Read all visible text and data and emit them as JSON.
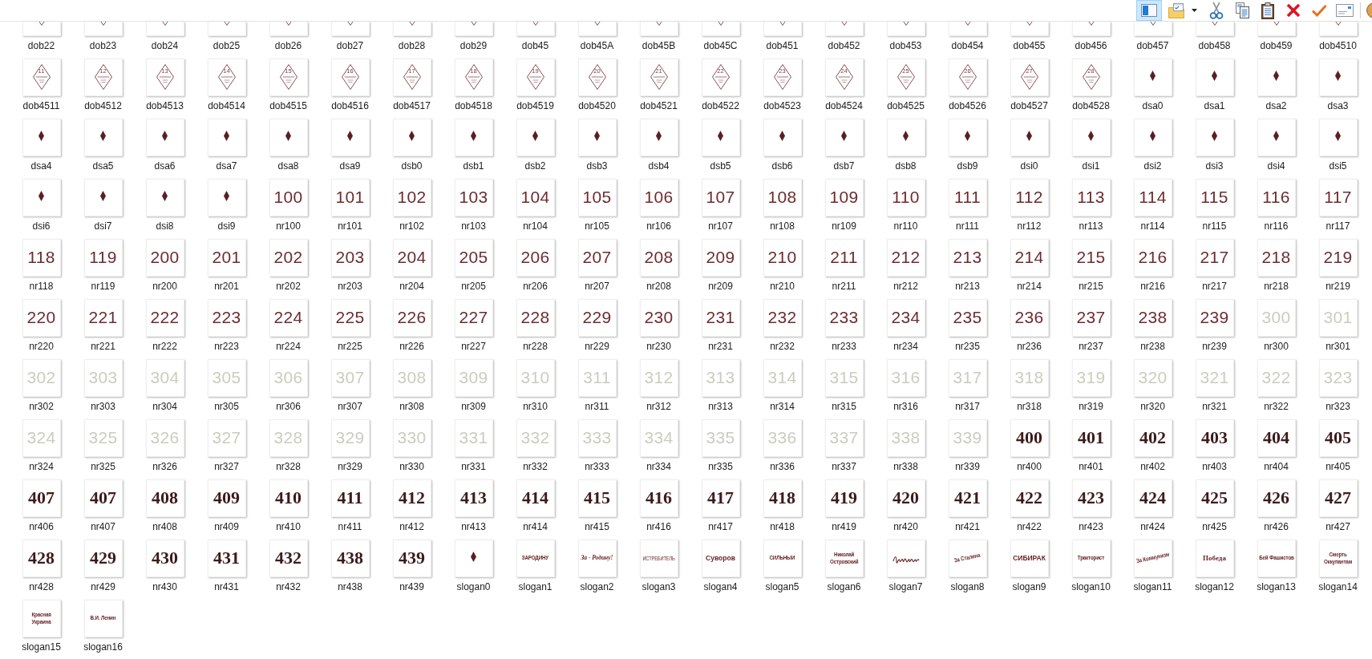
{
  "toolbar": {
    "pane_toggle": {
      "on": true
    },
    "buttons": [
      {
        "kind": "folder"
      },
      {
        "kind": "scissors"
      },
      {
        "kind": "copy"
      },
      {
        "kind": "paste"
      },
      {
        "kind": "delete"
      },
      {
        "kind": "check"
      },
      {
        "kind": "mail"
      },
      {
        "kind": "globe"
      }
    ]
  },
  "files": [
    {
      "name": "dob22",
      "kind": "rhombus"
    },
    {
      "name": "dob23",
      "kind": "rhombus"
    },
    {
      "name": "dob24",
      "kind": "rhombus"
    },
    {
      "name": "dob25",
      "kind": "rhombus"
    },
    {
      "name": "dob26",
      "kind": "rhombus"
    },
    {
      "name": "dob27",
      "kind": "rhombus"
    },
    {
      "name": "dob28",
      "kind": "rhombus"
    },
    {
      "name": "dob29",
      "kind": "rhombus"
    },
    {
      "name": "dob45",
      "kind": "rhombus"
    },
    {
      "name": "dob45A",
      "kind": "rhombus"
    },
    {
      "name": "dob45B",
      "kind": "rhombus"
    },
    {
      "name": "dob45C",
      "kind": "rhombus"
    },
    {
      "name": "dob451",
      "kind": "rhombus"
    },
    {
      "name": "dob452",
      "kind": "rhombus"
    },
    {
      "name": "dob453",
      "kind": "rhombus"
    },
    {
      "name": "dob454",
      "kind": "rhombus"
    },
    {
      "name": "dob455",
      "kind": "rhombus"
    },
    {
      "name": "dob456",
      "kind": "rhombus"
    },
    {
      "name": "dob457",
      "kind": "rhombus"
    },
    {
      "name": "dob458",
      "kind": "rhombus"
    },
    {
      "name": "dob459",
      "kind": "rhombus"
    },
    {
      "name": "dob4510",
      "kind": "rhombus"
    },
    {
      "name": "dob4511",
      "kind": "rhombus",
      "emblem": "11"
    },
    {
      "name": "dob4512",
      "kind": "rhombus",
      "emblem": "12"
    },
    {
      "name": "dob4513",
      "kind": "rhombus",
      "emblem": "13"
    },
    {
      "name": "dob4514",
      "kind": "rhombus",
      "emblem": "14"
    },
    {
      "name": "dob4515",
      "kind": "rhombus",
      "emblem": "15"
    },
    {
      "name": "dob4516",
      "kind": "rhombus",
      "emblem": "16"
    },
    {
      "name": "dob4517",
      "kind": "rhombus",
      "emblem": "17"
    },
    {
      "name": "dob4518",
      "kind": "rhombus",
      "emblem": "18"
    },
    {
      "name": "dob4519",
      "kind": "rhombus",
      "emblem": "19"
    },
    {
      "name": "dob4520",
      "kind": "rhombus",
      "emblem": "20"
    },
    {
      "name": "dob4521",
      "kind": "rhombus",
      "emblem": "21"
    },
    {
      "name": "dob4522",
      "kind": "rhombus",
      "emblem": "22"
    },
    {
      "name": "dob4523",
      "kind": "rhombus",
      "emblem": "23"
    },
    {
      "name": "dob4524",
      "kind": "rhombus",
      "emblem": "24"
    },
    {
      "name": "dob4525",
      "kind": "rhombus",
      "emblem": "25"
    },
    {
      "name": "dob4526",
      "kind": "rhombus",
      "emblem": "26"
    },
    {
      "name": "dob4527",
      "kind": "rhombus",
      "emblem": "27"
    },
    {
      "name": "dob4528",
      "kind": "rhombus",
      "emblem": "28"
    },
    {
      "name": "dsa0",
      "kind": "diamond"
    },
    {
      "name": "dsa1",
      "kind": "diamond"
    },
    {
      "name": "dsa2",
      "kind": "diamond"
    },
    {
      "name": "dsa3",
      "kind": "diamond"
    },
    {
      "name": "dsa4",
      "kind": "diamond"
    },
    {
      "name": "dsa5",
      "kind": "diamond"
    },
    {
      "name": "dsa6",
      "kind": "diamond"
    },
    {
      "name": "dsa7",
      "kind": "diamond"
    },
    {
      "name": "dsa8",
      "kind": "diamond"
    },
    {
      "name": "dsa9",
      "kind": "diamond"
    },
    {
      "name": "dsb0",
      "kind": "diamond"
    },
    {
      "name": "dsb1",
      "kind": "diamond"
    },
    {
      "name": "dsb2",
      "kind": "diamond"
    },
    {
      "name": "dsb3",
      "kind": "diamond"
    },
    {
      "name": "dsb4",
      "kind": "diamond"
    },
    {
      "name": "dsb5",
      "kind": "diamond"
    },
    {
      "name": "dsb6",
      "kind": "diamond"
    },
    {
      "name": "dsb7",
      "kind": "diamond"
    },
    {
      "name": "dsb8",
      "kind": "diamond"
    },
    {
      "name": "dsb9",
      "kind": "diamond"
    },
    {
      "name": "dsi0",
      "kind": "diamond"
    },
    {
      "name": "dsi1",
      "kind": "diamond"
    },
    {
      "name": "dsi2",
      "kind": "diamond"
    },
    {
      "name": "dsi3",
      "kind": "diamond"
    },
    {
      "name": "dsi4",
      "kind": "diamond"
    },
    {
      "name": "dsi5",
      "kind": "diamond"
    },
    {
      "name": "dsi6",
      "kind": "diamond"
    },
    {
      "name": "dsi7",
      "kind": "diamond"
    },
    {
      "name": "dsi8",
      "kind": "diamond"
    },
    {
      "name": "dsi9",
      "kind": "diamond"
    },
    {
      "name": "nr100",
      "kind": "number",
      "text": "100",
      "color": "#6e2b2f"
    },
    {
      "name": "nr101",
      "kind": "number",
      "text": "101",
      "color": "#6e2b2f"
    },
    {
      "name": "nr102",
      "kind": "number",
      "text": "102",
      "color": "#6e2b2f"
    },
    {
      "name": "nr103",
      "kind": "number",
      "text": "103",
      "color": "#6e2b2f"
    },
    {
      "name": "nr104",
      "kind": "number",
      "text": "104",
      "color": "#6e2b2f"
    },
    {
      "name": "nr105",
      "kind": "number",
      "text": "105",
      "color": "#6e2b2f"
    },
    {
      "name": "nr106",
      "kind": "number",
      "text": "106",
      "color": "#6e2b2f"
    },
    {
      "name": "nr107",
      "kind": "number",
      "text": "107",
      "color": "#6e2b2f"
    },
    {
      "name": "nr108",
      "kind": "number",
      "text": "108",
      "color": "#6e2b2f"
    },
    {
      "name": "nr109",
      "kind": "number",
      "text": "109",
      "color": "#6e2b2f"
    },
    {
      "name": "nr110",
      "kind": "number",
      "text": "110",
      "color": "#6e2b2f"
    },
    {
      "name": "nr111",
      "kind": "number",
      "text": "111",
      "color": "#6e2b2f"
    },
    {
      "name": "nr112",
      "kind": "number",
      "text": "112",
      "color": "#6e2b2f"
    },
    {
      "name": "nr113",
      "kind": "number",
      "text": "113",
      "color": "#6e2b2f"
    },
    {
      "name": "nr114",
      "kind": "number",
      "text": "114",
      "color": "#6e2b2f"
    },
    {
      "name": "nr115",
      "kind": "number",
      "text": "115",
      "color": "#6e2b2f"
    },
    {
      "name": "nr116",
      "kind": "number",
      "text": "116",
      "color": "#6e2b2f"
    },
    {
      "name": "nr117",
      "kind": "number",
      "text": "117",
      "color": "#6e2b2f"
    },
    {
      "name": "nr118",
      "kind": "number",
      "text": "118",
      "color": "#6e2b2f"
    },
    {
      "name": "nr119",
      "kind": "number",
      "text": "119",
      "color": "#6e2b2f"
    },
    {
      "name": "nr200",
      "kind": "number",
      "text": "200",
      "color": "#6e2b2f"
    },
    {
      "name": "nr201",
      "kind": "number",
      "text": "201",
      "color": "#6e2b2f"
    },
    {
      "name": "nr202",
      "kind": "number",
      "text": "202",
      "color": "#6e2b2f"
    },
    {
      "name": "nr203",
      "kind": "number",
      "text": "203",
      "color": "#6e2b2f"
    },
    {
      "name": "nr204",
      "kind": "number",
      "text": "204",
      "color": "#6e2b2f"
    },
    {
      "name": "nr205",
      "kind": "number",
      "text": "205",
      "color": "#6e2b2f"
    },
    {
      "name": "nr206",
      "kind": "number",
      "text": "206",
      "color": "#6e2b2f"
    },
    {
      "name": "nr207",
      "kind": "number",
      "text": "207",
      "color": "#6e2b2f"
    },
    {
      "name": "nr208",
      "kind": "number",
      "text": "208",
      "color": "#6e2b2f"
    },
    {
      "name": "nr209",
      "kind": "number",
      "text": "209",
      "color": "#6e2b2f"
    },
    {
      "name": "nr210",
      "kind": "number",
      "text": "210",
      "color": "#6e2b2f"
    },
    {
      "name": "nr211",
      "kind": "number",
      "text": "211",
      "color": "#6e2b2f"
    },
    {
      "name": "nr212",
      "kind": "number",
      "text": "212",
      "color": "#6e2b2f"
    },
    {
      "name": "nr213",
      "kind": "number",
      "text": "213",
      "color": "#6e2b2f"
    },
    {
      "name": "nr214",
      "kind": "number",
      "text": "214",
      "color": "#6e2b2f"
    },
    {
      "name": "nr215",
      "kind": "number",
      "text": "215",
      "color": "#6e2b2f"
    },
    {
      "name": "nr216",
      "kind": "number",
      "text": "216",
      "color": "#6e2b2f"
    },
    {
      "name": "nr217",
      "kind": "number",
      "text": "217",
      "color": "#6e2b2f"
    },
    {
      "name": "nr218",
      "kind": "number",
      "text": "218",
      "color": "#6e2b2f"
    },
    {
      "name": "nr219",
      "kind": "number",
      "text": "219",
      "color": "#6e2b2f"
    },
    {
      "name": "nr220",
      "kind": "number",
      "text": "220",
      "color": "#6e2b2f"
    },
    {
      "name": "nr221",
      "kind": "number",
      "text": "221",
      "color": "#6e2b2f"
    },
    {
      "name": "nr222",
      "kind": "number",
      "text": "222",
      "color": "#6e2b2f"
    },
    {
      "name": "nr223",
      "kind": "number",
      "text": "223",
      "color": "#6e2b2f"
    },
    {
      "name": "nr224",
      "kind": "number",
      "text": "224",
      "color": "#6e2b2f"
    },
    {
      "name": "nr225",
      "kind": "number",
      "text": "225",
      "color": "#6e2b2f"
    },
    {
      "name": "nr226",
      "kind": "number",
      "text": "226",
      "color": "#6e2b2f"
    },
    {
      "name": "nr227",
      "kind": "number",
      "text": "227",
      "color": "#6e2b2f"
    },
    {
      "name": "nr228",
      "kind": "number",
      "text": "228",
      "color": "#6e2b2f"
    },
    {
      "name": "nr229",
      "kind": "number",
      "text": "229",
      "color": "#6e2b2f"
    },
    {
      "name": "nr230",
      "kind": "number",
      "text": "230",
      "color": "#6e2b2f"
    },
    {
      "name": "nr231",
      "kind": "number",
      "text": "231",
      "color": "#6e2b2f"
    },
    {
      "name": "nr232",
      "kind": "number",
      "text": "232",
      "color": "#6e2b2f"
    },
    {
      "name": "nr233",
      "kind": "number",
      "text": "233",
      "color": "#6e2b2f"
    },
    {
      "name": "nr234",
      "kind": "number",
      "text": "234",
      "color": "#6e2b2f"
    },
    {
      "name": "nr235",
      "kind": "number",
      "text": "235",
      "color": "#6e2b2f"
    },
    {
      "name": "nr236",
      "kind": "number",
      "text": "236",
      "color": "#6e2b2f"
    },
    {
      "name": "nr237",
      "kind": "number",
      "text": "237",
      "color": "#6e2b2f"
    },
    {
      "name": "nr238",
      "kind": "number",
      "text": "238",
      "color": "#6e2b2f"
    },
    {
      "name": "nr239",
      "kind": "number",
      "text": "239",
      "color": "#6e2b2f"
    },
    {
      "name": "nr300",
      "kind": "number",
      "text": "300",
      "color": "#c8cec0"
    },
    {
      "name": "nr301",
      "kind": "number",
      "text": "301",
      "color": "#c8cec0"
    },
    {
      "name": "nr302",
      "kind": "number",
      "text": "302",
      "color": "#c8cec0"
    },
    {
      "name": "nr303",
      "kind": "number",
      "text": "303",
      "color": "#c8cec0"
    },
    {
      "name": "nr304",
      "kind": "number",
      "text": "304",
      "color": "#c8cec0"
    },
    {
      "name": "nr305",
      "kind": "number",
      "text": "305",
      "color": "#c8cec0"
    },
    {
      "name": "nr306",
      "kind": "number",
      "text": "306",
      "color": "#c8cec0"
    },
    {
      "name": "nr307",
      "kind": "number",
      "text": "307",
      "color": "#c8cec0"
    },
    {
      "name": "nr308",
      "kind": "number",
      "text": "308",
      "color": "#c8cec0"
    },
    {
      "name": "nr309",
      "kind": "number",
      "text": "309",
      "color": "#c8cec0"
    },
    {
      "name": "nr310",
      "kind": "number",
      "text": "310",
      "color": "#c8cec0"
    },
    {
      "name": "nr311",
      "kind": "number",
      "text": "311",
      "color": "#c8cec0"
    },
    {
      "name": "nr312",
      "kind": "number",
      "text": "312",
      "color": "#c8cec0"
    },
    {
      "name": "nr313",
      "kind": "number",
      "text": "313",
      "color": "#c8cec0"
    },
    {
      "name": "nr314",
      "kind": "number",
      "text": "314",
      "color": "#c8cec0"
    },
    {
      "name": "nr315",
      "kind": "number",
      "text": "315",
      "color": "#c8cec0"
    },
    {
      "name": "nr316",
      "kind": "number",
      "text": "316",
      "color": "#c8cec0"
    },
    {
      "name": "nr317",
      "kind": "number",
      "text": "317",
      "color": "#c8cec0"
    },
    {
      "name": "nr318",
      "kind": "number",
      "text": "318",
      "color": "#c8cec0"
    },
    {
      "name": "nr319",
      "kind": "number",
      "text": "319",
      "color": "#c8cec0"
    },
    {
      "name": "nr320",
      "kind": "number",
      "text": "320",
      "color": "#c8cec0"
    },
    {
      "name": "nr321",
      "kind": "number",
      "text": "321",
      "color": "#c8cec0"
    },
    {
      "name": "nr322",
      "kind": "number",
      "text": "322",
      "color": "#c8cec0"
    },
    {
      "name": "nr323",
      "kind": "number",
      "text": "323",
      "color": "#c8cec0"
    },
    {
      "name": "nr324",
      "kind": "number",
      "text": "324",
      "color": "#c8cec0"
    },
    {
      "name": "nr325",
      "kind": "number",
      "text": "325",
      "color": "#c8cec0"
    },
    {
      "name": "nr326",
      "kind": "number",
      "text": "326",
      "color": "#c8cec0"
    },
    {
      "name": "nr327",
      "kind": "number",
      "text": "327",
      "color": "#c8cec0"
    },
    {
      "name": "nr328",
      "kind": "number",
      "text": "328",
      "color": "#c8cec0"
    },
    {
      "name": "nr329",
      "kind": "number",
      "text": "329",
      "color": "#c8cec0"
    },
    {
      "name": "nr330",
      "kind": "number",
      "text": "330",
      "color": "#c8cec0"
    },
    {
      "name": "nr331",
      "kind": "number",
      "text": "331",
      "color": "#c8cec0"
    },
    {
      "name": "nr332",
      "kind": "number",
      "text": "332",
      "color": "#c8cec0"
    },
    {
      "name": "nr333",
      "kind": "number",
      "text": "333",
      "color": "#c8cec0"
    },
    {
      "name": "nr334",
      "kind": "number",
      "text": "334",
      "color": "#c8cec0"
    },
    {
      "name": "nr335",
      "kind": "number",
      "text": "335",
      "color": "#c8cec0"
    },
    {
      "name": "nr336",
      "kind": "number",
      "text": "336",
      "color": "#c8cec0"
    },
    {
      "name": "nr337",
      "kind": "number",
      "text": "337",
      "color": "#c8cec0"
    },
    {
      "name": "nr338",
      "kind": "number",
      "text": "338",
      "color": "#c8cec0"
    },
    {
      "name": "nr339",
      "kind": "number",
      "text": "339",
      "color": "#c8cec0"
    },
    {
      "name": "nr400",
      "kind": "stencil",
      "text": "400",
      "color": "#3d1b1c"
    },
    {
      "name": "nr401",
      "kind": "stencil",
      "text": "401",
      "color": "#3d1b1c"
    },
    {
      "name": "nr402",
      "kind": "stencil",
      "text": "402",
      "color": "#3d1b1c"
    },
    {
      "name": "nr403",
      "kind": "stencil",
      "text": "403",
      "color": "#3d1b1c"
    },
    {
      "name": "nr404",
      "kind": "stencil",
      "text": "404",
      "color": "#3d1b1c"
    },
    {
      "name": "nr405",
      "kind": "stencil",
      "text": "405",
      "color": "#3d1b1c"
    },
    {
      "name": "nr406",
      "kind": "stencil",
      "text": "407",
      "color": "#3d1b1c"
    },
    {
      "name": "nr407",
      "kind": "stencil",
      "text": "407",
      "color": "#3d1b1c"
    },
    {
      "name": "nr408",
      "kind": "stencil",
      "text": "408",
      "color": "#3d1b1c"
    },
    {
      "name": "nr409",
      "kind": "stencil",
      "text": "409",
      "color": "#3d1b1c"
    },
    {
      "name": "nr410",
      "kind": "stencil",
      "text": "410",
      "color": "#3d1b1c"
    },
    {
      "name": "nr411",
      "kind": "stencil",
      "text": "411",
      "color": "#3d1b1c"
    },
    {
      "name": "nr412",
      "kind": "stencil",
      "text": "412",
      "color": "#3d1b1c"
    },
    {
      "name": "nr413",
      "kind": "stencil",
      "text": "413",
      "color": "#3d1b1c"
    },
    {
      "name": "nr414",
      "kind": "stencil",
      "text": "414",
      "color": "#3d1b1c"
    },
    {
      "name": "nr415",
      "kind": "stencil",
      "text": "415",
      "color": "#3d1b1c"
    },
    {
      "name": "nr416",
      "kind": "stencil",
      "text": "416",
      "color": "#3d1b1c"
    },
    {
      "name": "nr417",
      "kind": "stencil",
      "text": "417",
      "color": "#3d1b1c"
    },
    {
      "name": "nr418",
      "kind": "stencil",
      "text": "418",
      "color": "#3d1b1c"
    },
    {
      "name": "nr419",
      "kind": "stencil",
      "text": "419",
      "color": "#3d1b1c"
    },
    {
      "name": "nr420",
      "kind": "stencil",
      "text": "420",
      "color": "#3d1b1c"
    },
    {
      "name": "nr421",
      "kind": "stencil",
      "text": "421",
      "color": "#3d1b1c"
    },
    {
      "name": "nr422",
      "kind": "stencil",
      "text": "422",
      "color": "#3d1b1c"
    },
    {
      "name": "nr423",
      "kind": "stencil",
      "text": "423",
      "color": "#3d1b1c"
    },
    {
      "name": "nr424",
      "kind": "stencil",
      "text": "424",
      "color": "#3d1b1c"
    },
    {
      "name": "nr425",
      "kind": "stencil",
      "text": "425",
      "color": "#3d1b1c"
    },
    {
      "name": "nr426",
      "kind": "stencil",
      "text": "426",
      "color": "#3d1b1c"
    },
    {
      "name": "nr427",
      "kind": "stencil",
      "text": "427",
      "color": "#3d1b1c"
    },
    {
      "name": "nr428",
      "kind": "stencil",
      "text": "428",
      "color": "#3d1b1c"
    },
    {
      "name": "nr429",
      "kind": "stencil",
      "text": "429",
      "color": "#3d1b1c"
    },
    {
      "name": "nr430",
      "kind": "stencil",
      "text": "430",
      "color": "#3d1b1c"
    },
    {
      "name": "nr431",
      "kind": "stencil",
      "text": "431",
      "color": "#3d1b1c"
    },
    {
      "name": "nr432",
      "kind": "stencil",
      "text": "432",
      "color": "#3d1b1c"
    },
    {
      "name": "nr438",
      "kind": "stencil",
      "text": "438",
      "color": "#3d1b1c"
    },
    {
      "name": "nr439",
      "kind": "stencil",
      "text": "439",
      "color": "#3d1b1c"
    },
    {
      "name": "slogan0",
      "kind": "diamond"
    },
    {
      "name": "slogan1",
      "kind": "caps",
      "text": "ЗАРОДИНУ"
    },
    {
      "name": "slogan2",
      "kind": "italic",
      "text": "За - Родину!"
    },
    {
      "name": "slogan3",
      "kind": "thin",
      "text": "ИСТРЕБИТЕЛЬ"
    },
    {
      "name": "slogan4",
      "kind": "heavy",
      "text": "Суворов"
    },
    {
      "name": "slogan5",
      "kind": "caps",
      "text": "СИЛЬНЫИ"
    },
    {
      "name": "slogan6",
      "kind": "caps",
      "text": "Николай\nОстровский"
    },
    {
      "name": "slogan7",
      "kind": "scribble"
    },
    {
      "name": "slogan8",
      "kind": "tilted",
      "text": "За Сталина"
    },
    {
      "name": "slogan9",
      "kind": "heavy",
      "text": "СИБИРАК"
    },
    {
      "name": "slogan10",
      "kind": "caps",
      "text": "Тракторист"
    },
    {
      "name": "slogan11",
      "kind": "tilted",
      "text": "За Коммунизм"
    },
    {
      "name": "slogan12",
      "kind": "serif",
      "text": "Победа"
    },
    {
      "name": "slogan13",
      "kind": "caps",
      "text": "Бей Фашистов"
    },
    {
      "name": "slogan14",
      "kind": "caps",
      "text": "Смерть\nОккупантам"
    },
    {
      "name": "slogan15",
      "kind": "caps",
      "text": "Красная\nУкраина"
    },
    {
      "name": "slogan16",
      "kind": "caps",
      "text": "В.И. Ленин"
    }
  ]
}
